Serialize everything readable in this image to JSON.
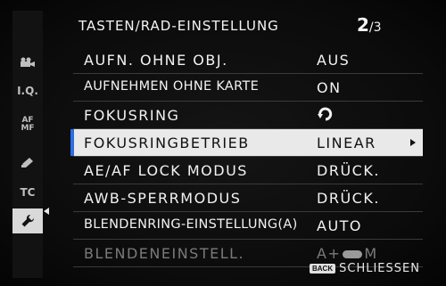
{
  "header": {
    "title": "TASTEN/RAD-EINSTELLUNG",
    "page_current": "2",
    "page_total": "3"
  },
  "sidebar": {
    "items": [
      {
        "icon": "movie-camera-icon",
        "label": ""
      },
      {
        "icon": "image-quality-icon",
        "label": "I.Q."
      },
      {
        "icon": "af-mf-icon",
        "label": "AF MF"
      },
      {
        "icon": "flash-icon",
        "label": ""
      },
      {
        "icon": "tc-icon",
        "label": "TC"
      },
      {
        "icon": "wrench-icon",
        "label": ""
      }
    ],
    "active_index": 5
  },
  "menu": {
    "rows": [
      {
        "label": "AUFN. OHNE OBJ.",
        "value": "AUS"
      },
      {
        "label": "AUFNEHMEN OHNE KARTE",
        "value": "ON"
      },
      {
        "label": "FOKUSRING",
        "value": "",
        "value_icon": "clockwise-rotation-icon"
      },
      {
        "label": "FOKUSRINGBETRIEB",
        "value": "LINEAR"
      },
      {
        "label": "AE/AF LOCK MODUS",
        "value": "DRÜCK."
      },
      {
        "label": "AWB-SPERRMODUS",
        "value": "DRÜCK."
      },
      {
        "label": "BLENDENRING-EINSTELLUNG(A)",
        "value": "AUTO"
      },
      {
        "label": "BLENDENEINSTELL.",
        "value_prefix": "A+",
        "value_icon": "aperture-ring-icon",
        "value_suffix": "M"
      }
    ],
    "selected_index": 3
  },
  "footer": {
    "back_badge": "BACK",
    "label": "SCHLIESSEN"
  },
  "colors": {
    "background": "#0a0a0a",
    "selected_row": "#e9e9e9",
    "selection_marker": "#2b6fe0",
    "text": "#f2f2f2",
    "dim_text": "#7a7a7a"
  }
}
